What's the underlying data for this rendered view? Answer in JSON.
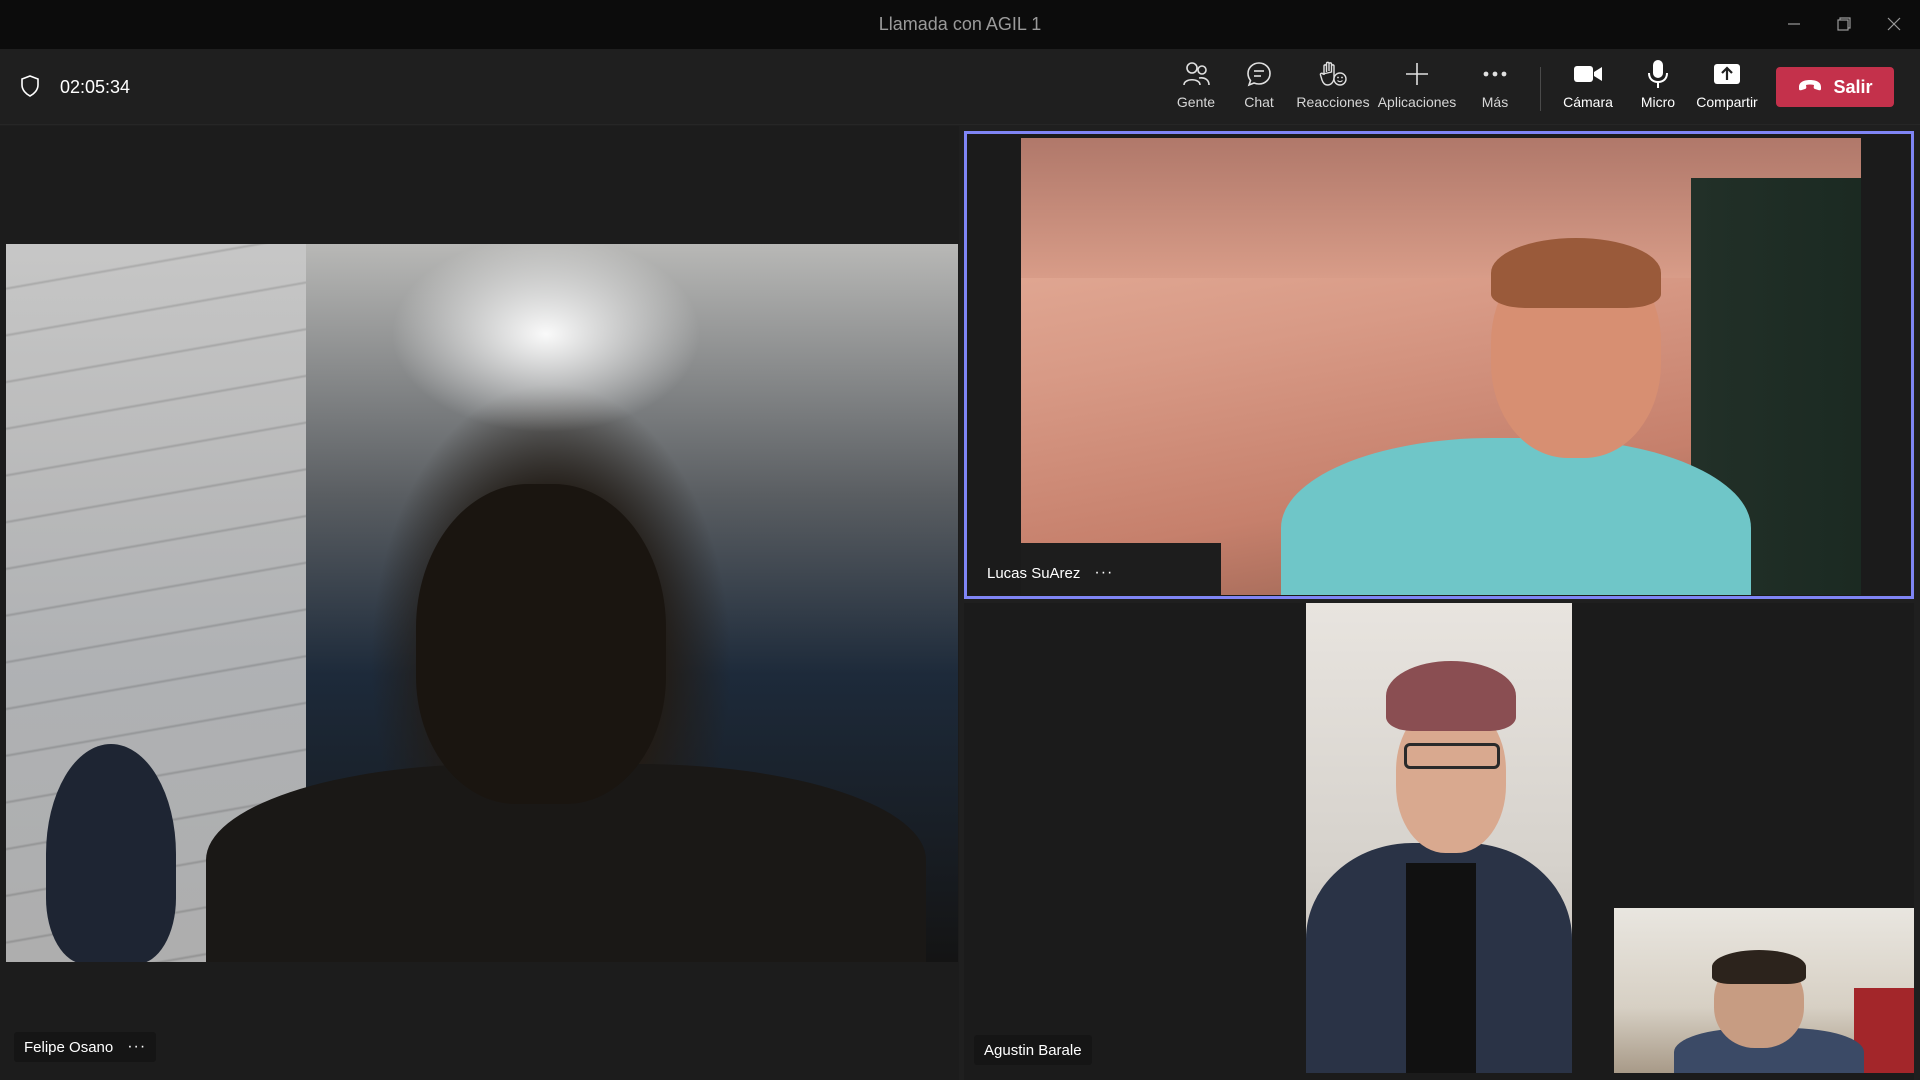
{
  "window": {
    "title": "Llamada con AGIL 1",
    "minimize_icon": "minimize-icon",
    "restore_icon": "restore-icon",
    "close_icon": "close-icon"
  },
  "call": {
    "timer": "02:05:34",
    "shield_icon": "shield-icon"
  },
  "toolbar": {
    "items": [
      {
        "label": "Gente",
        "icon": "people-icon"
      },
      {
        "label": "Chat",
        "icon": "chat-icon"
      },
      {
        "label": "Reacciones",
        "icon": "reactions-icon"
      },
      {
        "label": "Aplicaciones",
        "icon": "plus-icon"
      },
      {
        "label": "Más",
        "icon": "more-icon"
      },
      {
        "label": "Cámara",
        "icon": "camera-icon"
      },
      {
        "label": "Micro",
        "icon": "microphone-icon"
      },
      {
        "label": "Compartir",
        "icon": "share-icon"
      }
    ],
    "leave": {
      "label": "Salir",
      "icon": "hang-up-icon",
      "color": "#c4314b"
    }
  },
  "participants": [
    {
      "name": "Felipe Osano",
      "more": "···"
    },
    {
      "name": "Lucas SuArez",
      "more": "···",
      "speaking": true,
      "highlight_color": "#7f85f5"
    },
    {
      "name": "Agustin Barale"
    }
  ]
}
